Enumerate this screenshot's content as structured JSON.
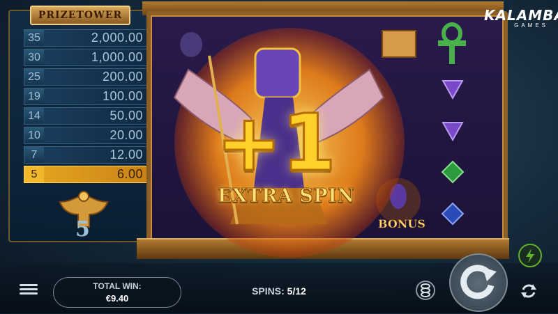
{
  "prize_tower": {
    "title": "PRIZETOWER",
    "tiers": [
      {
        "level": "35",
        "amount": "2,000.00",
        "active": false
      },
      {
        "level": "30",
        "amount": "1,000.00",
        "active": false
      },
      {
        "level": "25",
        "amount": "200.00",
        "active": false
      },
      {
        "level": "19",
        "amount": "100.00",
        "active": false
      },
      {
        "level": "14",
        "amount": "50.00",
        "active": false
      },
      {
        "level": "10",
        "amount": "20.00",
        "active": false
      },
      {
        "level": "7",
        "amount": "12.00",
        "active": false
      },
      {
        "level": "5",
        "amount": "6.00",
        "active": true
      }
    ],
    "collected_count": "5"
  },
  "logo": {
    "main": "KALAMBA",
    "sub": "GAMES"
  },
  "overlay": {
    "big_text": "+1",
    "subtitle": "EXTRA SPIN"
  },
  "reels": {
    "symbols": [
      "scarab-jar-icon",
      "papyrus-scroll-icon",
      "ankh-icon",
      "purple-gem-icon",
      "purple-gem-icon",
      "green-gem-icon",
      "blue-gem-icon",
      "horus-bonus-icon"
    ],
    "bonus_label": "BONUS"
  },
  "bottom_bar": {
    "total_win_label": "TOTAL WIN:",
    "total_win_value": "€9.40",
    "spins_label": "SPINS:",
    "spins_value": "5/12"
  },
  "colors": {
    "accent_gold": "#ffcf2a",
    "tower_active": "#e8a820",
    "turbo_green": "#63b12d"
  }
}
